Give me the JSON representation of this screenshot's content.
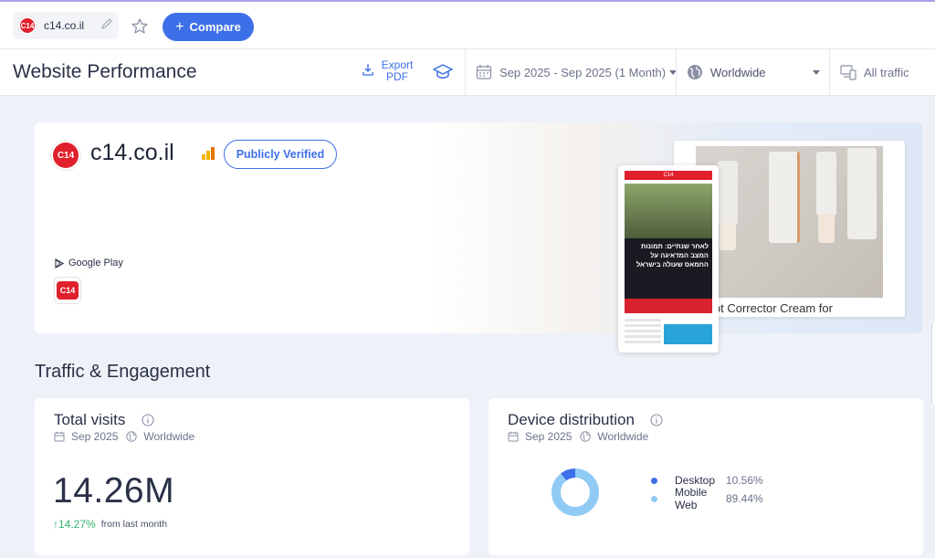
{
  "topbar": {
    "site_name": "c14.co.il",
    "logo_text": "C14",
    "compare_label": "Compare",
    "compare_plus": "+"
  },
  "header": {
    "title": "Website Performance",
    "export_label": "Export PDF",
    "date_range": "Sep 2025 - Sep 2025 (1 Month)",
    "geo": "Worldwide",
    "traffic": "All traffic"
  },
  "hero": {
    "logo_text": "C14",
    "domain": "c14.co.il",
    "verified_label": "Publicly Verified",
    "store_label": "Google Play",
    "app_icon_text": "C14",
    "desktop_caption": "Spot Corrector Cream for",
    "mobile_bar": "C14",
    "mobile_headline": "לאחר שנתיים: תמונות המצב המדאיגה על החמאס שעולה בישראל"
  },
  "section": {
    "title": "Traffic & Engagement"
  },
  "visits": {
    "title": "Total visits",
    "date": "Sep 2025",
    "geo": "Worldwide",
    "value": "14.26M",
    "delta": "14.27%",
    "delta_arrow": "↑",
    "delta_suffix": "from last month"
  },
  "devices": {
    "title": "Device distribution",
    "date": "Sep 2025",
    "geo": "Worldwide",
    "items": [
      {
        "label": "Desktop",
        "value": "10.56%",
        "fraction": 0.1056,
        "color": "#3d6fe8"
      },
      {
        "label": "Mobile Web",
        "value": "89.44%",
        "fraction": 0.8944,
        "color": "#8fcbf5"
      }
    ]
  },
  "colors": {
    "accent": "#3d6fe8",
    "brand_red": "#e0202c",
    "positive": "#2fb36b"
  }
}
